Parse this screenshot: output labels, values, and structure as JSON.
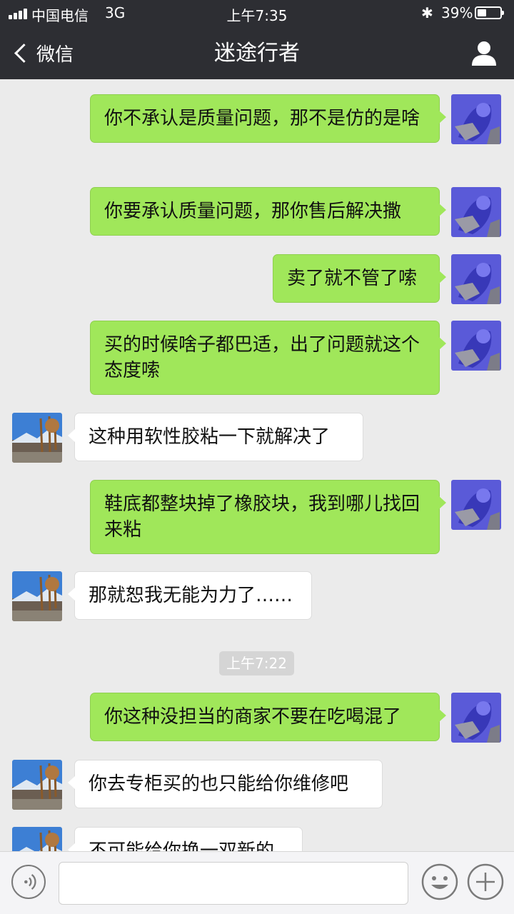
{
  "status_bar": {
    "carrier": "中国电信",
    "network": "3G",
    "time": "上午7:35",
    "bluetooth_icon": "bluetooth-icon",
    "battery_percent": "39%",
    "battery_level": 0.39
  },
  "nav": {
    "back_label": "微信",
    "title": "迷途行者",
    "profile_icon": "person-icon"
  },
  "messages": [
    {
      "side": "me",
      "text": "你不承认是质量问题，那不是仿的是啥"
    },
    {
      "side": "me",
      "text": "你要承认质量问题，那你售后解决撒"
    },
    {
      "side": "me",
      "text": "卖了就不管了嗦"
    },
    {
      "side": "me",
      "text": "买的时候啥子都巴适，出了问题就这个态度嗦"
    },
    {
      "side": "them",
      "text": "这种用软性胶粘一下就解决了"
    },
    {
      "side": "me",
      "text": "鞋底都整块掉了橡胶块，我到哪儿找回来粘"
    },
    {
      "side": "them",
      "text": "那就恕我无能为力了……"
    },
    {
      "timestamp": "上午7:22"
    },
    {
      "side": "me",
      "text": "你这种没担当的商家不要在吃喝混了"
    },
    {
      "side": "them",
      "text": "你去专柜买的也只能给你维修吧"
    },
    {
      "side": "them",
      "text": "不可能给你换一双新的"
    }
  ],
  "input_bar": {
    "voice_icon": "voice-icon",
    "text_value": "",
    "emoji_icon": "emoji-icon",
    "plus_icon": "plus-icon"
  },
  "colors": {
    "nav_bg": "#2d2e33",
    "chat_bg": "#ebebeb",
    "my_bubble": "#a0e75a",
    "their_bubble": "#ffffff",
    "timestamp_bg": "#d5d5d5"
  }
}
